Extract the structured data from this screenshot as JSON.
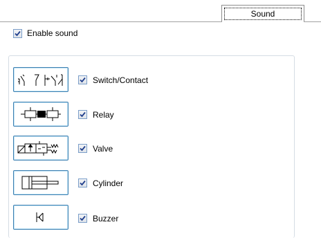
{
  "tab": {
    "label": "Sound"
  },
  "enable_sound": {
    "label": "Enable sound",
    "checked": true
  },
  "components": [
    {
      "name": "Switch/Contact",
      "icon": "switch-contact-icon",
      "checked": true
    },
    {
      "name": "Relay",
      "icon": "relay-icon",
      "checked": true
    },
    {
      "name": "Valve",
      "icon": "valve-icon",
      "checked": true
    },
    {
      "name": "Cylinder",
      "icon": "cylinder-icon",
      "checked": true
    },
    {
      "name": "Buzzer",
      "icon": "buzzer-icon",
      "checked": true
    }
  ],
  "colors": {
    "accent_border": "#3c7fb1",
    "check": "#1f3e8c"
  }
}
